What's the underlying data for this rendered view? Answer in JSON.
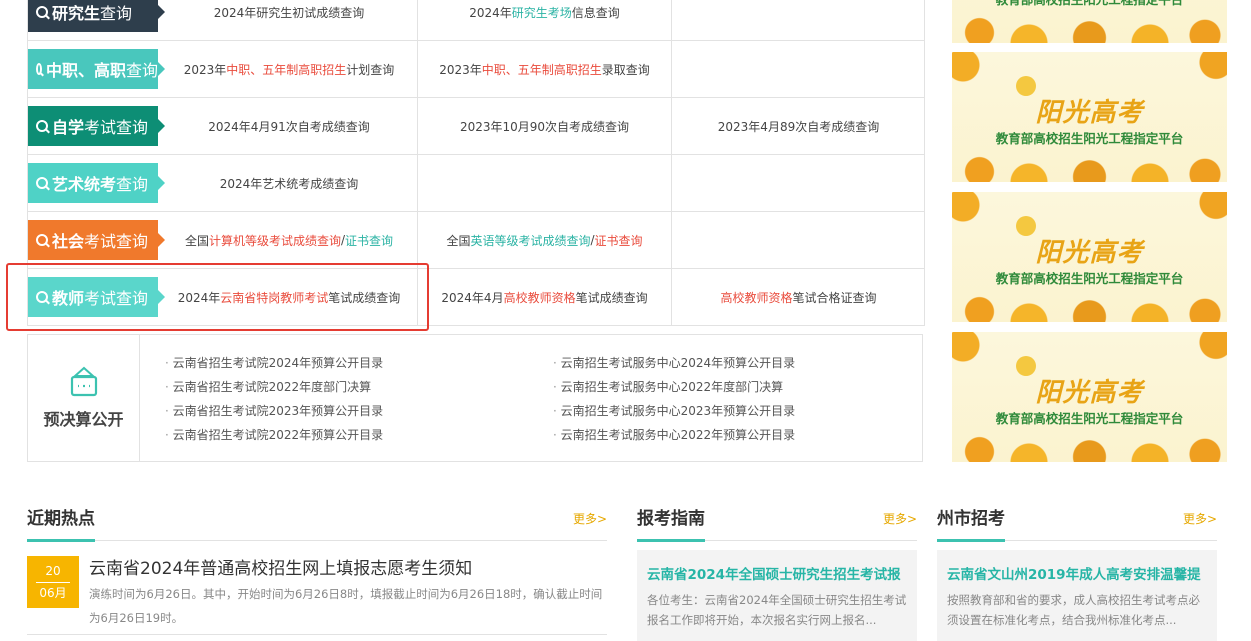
{
  "query_rows": [
    {
      "label_bold": "研究生",
      "label_rest": "查询",
      "color": "#2e3e4c",
      "cells": [
        [
          {
            "t": "2024年研究生初试成绩查询"
          }
        ],
        [
          {
            "t": "2024年"
          },
          {
            "t": "研究生考场",
            "c": "teal"
          },
          {
            "t": "信息查询"
          }
        ],
        []
      ]
    },
    {
      "label_bold": "中职、高职",
      "label_rest": "查询",
      "color": "#49c7bd",
      "cells": [
        [
          {
            "t": "2023年"
          },
          {
            "t": "中职、五年制高职招生",
            "c": "red"
          },
          {
            "t": "计划查询"
          }
        ],
        [
          {
            "t": "2023年"
          },
          {
            "t": "中职、五年制高职招生",
            "c": "red"
          },
          {
            "t": "录取查询"
          }
        ],
        []
      ]
    },
    {
      "label_bold": "自学",
      "label_rest": "考试查询",
      "color": "#0d8e75",
      "cells": [
        [
          {
            "t": "2024年4月91次自考成绩查询"
          }
        ],
        [
          {
            "t": "2023年10月90次自考成绩查询"
          }
        ],
        [
          {
            "t": "2023年4月89次自考成绩查询"
          }
        ]
      ]
    },
    {
      "label_bold": "艺术统考",
      "label_rest": "查询",
      "color": "#4fd2c6",
      "cells": [
        [
          {
            "t": "2024年艺术统考成绩查询"
          }
        ],
        [],
        []
      ]
    },
    {
      "label_bold": "社会",
      "label_rest": "考试查询",
      "color": "#f0792c",
      "cells": [
        [
          {
            "t": "全国"
          },
          {
            "t": "计算机等级考试成绩查询",
            "c": "red"
          },
          {
            "t": " / "
          },
          {
            "t": "证书查询",
            "c": "teal"
          }
        ],
        [
          {
            "t": "全国"
          },
          {
            "t": "英语等级考试成绩查询",
            "c": "teal"
          },
          {
            "t": " / "
          },
          {
            "t": "证书查询",
            "c": "red"
          }
        ],
        []
      ]
    },
    {
      "label_bold": "教师",
      "label_rest": "考试查询",
      "color": "#5ad6cb",
      "cells": [
        [
          {
            "t": "2024年"
          },
          {
            "t": "云南省特岗教师考试",
            "c": "red"
          },
          {
            "t": "笔试成绩查询"
          }
        ],
        [
          {
            "t": "2024年4月"
          },
          {
            "t": "高校教师资格",
            "c": "red"
          },
          {
            "t": "笔试成绩查询"
          }
        ],
        [
          {
            "t": "高校教师资格",
            "c": "red"
          },
          {
            "t": "笔试合格证查询"
          }
        ]
      ]
    }
  ],
  "budget": {
    "title": "预决算公开",
    "left": [
      "云南省招生考试院2024年预算公开目录",
      "云南省招生考试院2022年度部门决算",
      "云南省招生考试院2023年预算公开目录",
      "云南省招生考试院2022年预算公开目录"
    ],
    "right": [
      "云南招生考试服务中心2024年预算公开目录",
      "云南招生考试服务中心2022年度部门决算",
      "云南招生考试服务中心2023年预算公开目录",
      "云南招生考试服务中心2022年预算公开目录"
    ]
  },
  "banner": {
    "title": "阳光高考",
    "subtitle": "教育部高校招生阳光工程指定平台"
  },
  "hot": {
    "title": "近期热点",
    "more": "更多>",
    "date_day": "20",
    "date_month": "06月",
    "news_title": "云南省2024年普通高校招生网上填报志愿考生须知",
    "news_text": "演练时间为6月26日。其中，开始时间为6月26日8时，填报截止时间为6月26日18时，确认截止时间为6月26日19时。"
  },
  "guide": {
    "title": "报考指南",
    "more": "更多>",
    "card_title": "云南省2024年全国硕士研究生招生考试报",
    "card_text": "各位考生：云南省2024年全国硕士研究生招生考试报名工作即将开始，本次报名实行网上报名..."
  },
  "prefecture": {
    "title": "州市招考",
    "more": "更多>",
    "card_title": "云南省文山州2019年成人高考安排温馨提",
    "card_text": "按照教育部和省的要求，成人高校招生考试考点必须设置在标准化考点，结合我州标准化考点..."
  }
}
